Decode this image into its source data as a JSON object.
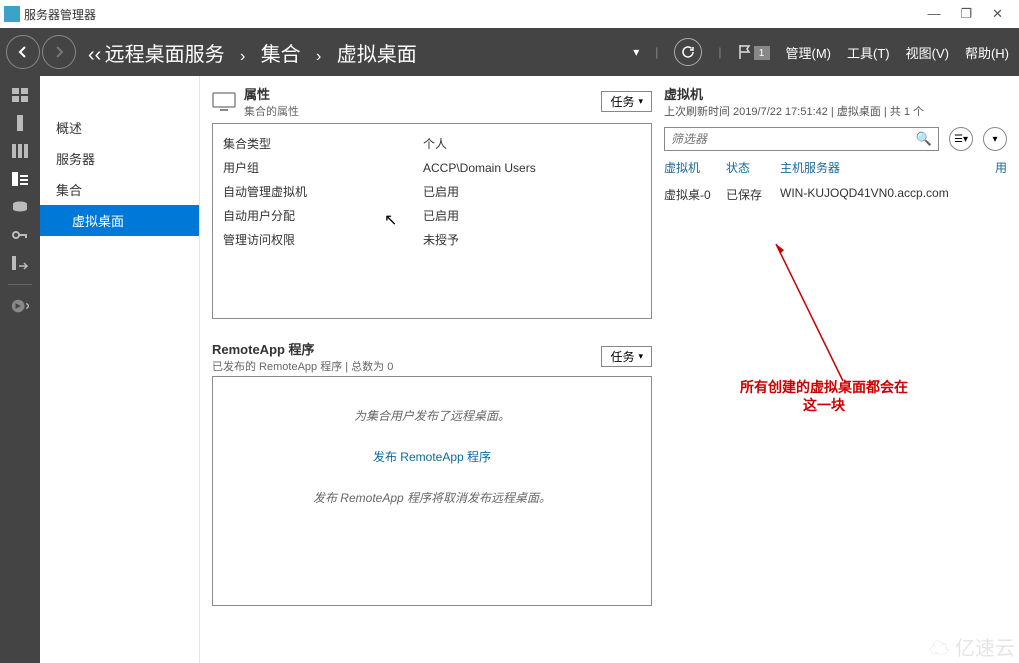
{
  "app": {
    "title": "服务器管理器"
  },
  "win_controls": {
    "min": "—",
    "max": "❐",
    "close": "✕"
  },
  "breadcrumb": {
    "guillemets": "‹‹",
    "p1": "远程桌面服务",
    "p2": "集合",
    "p3": "虚拟桌面"
  },
  "header_dd": "▾",
  "flag_count": "1",
  "menu": {
    "manage": "管理(M)",
    "tools": "工具(T)",
    "view": "视图(V)",
    "help": "帮助(H)"
  },
  "sidebar": {
    "overview": "概述",
    "server": "服务器",
    "collection": "集合",
    "vdesktop": "虚拟桌面"
  },
  "props": {
    "title": "属性",
    "subtitle": "集合的属性",
    "task": "任务",
    "rows": [
      {
        "label": "集合类型",
        "value": "个人"
      },
      {
        "label": "用户组",
        "value": "ACCP\\Domain Users"
      },
      {
        "label": "自动管理虚拟机",
        "value": "已启用"
      },
      {
        "label": "自动用户分配",
        "value": "已启用"
      },
      {
        "label": "管理访问权限",
        "value": "未授予"
      }
    ]
  },
  "remote": {
    "title": "RemoteApp 程序",
    "subtitle": "已发布的 RemoteApp 程序 | 总数为 0",
    "task": "任务",
    "status": "为集合用户发布了远程桌面。",
    "link": "发布 RemoteApp 程序",
    "note": "发布 RemoteApp 程序将取消发布远程桌面。"
  },
  "vm": {
    "title": "虚拟机",
    "subtitle": "上次刷新时间 2019/7/22 17:51:42 | 虚拟桌面 | 共 1 个",
    "filter_placeholder": "筛选器",
    "cols": {
      "c1": "虚拟机",
      "c2": "状态",
      "c3": "主机服务器",
      "c4": "用"
    },
    "row": {
      "c1": "虚拟桌-0",
      "c2": "已保存",
      "c3": "WIN-KUJOQD41VN0.accp.com"
    }
  },
  "annotation": "所有创建的虚拟桌面都会在\n这一块",
  "watermark": "亿速云"
}
